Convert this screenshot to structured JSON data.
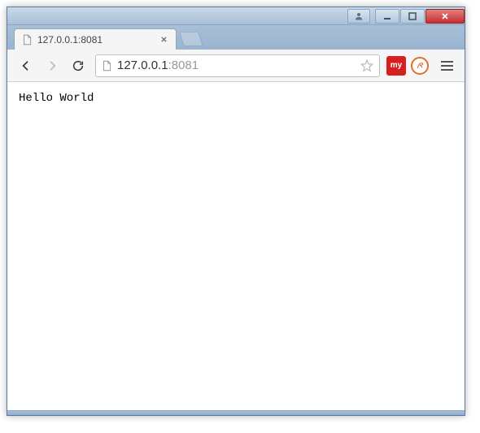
{
  "window": {
    "controls": {
      "user": "user",
      "minimize": "minimize",
      "maximize": "maximize",
      "close": "close"
    }
  },
  "tabs": [
    {
      "title": "127.0.0.1:8081",
      "favicon": "file-icon"
    }
  ],
  "toolbar": {
    "back": "back",
    "forward": "forward",
    "reload": "reload",
    "menu": "menu"
  },
  "omnibox": {
    "favicon": "file-icon",
    "host": "127.0.0.1",
    "port": ":8081",
    "bookmark": "star"
  },
  "extensions": [
    {
      "name": "my-extension",
      "label": "my",
      "style": "red-box"
    },
    {
      "name": "scribe-extension",
      "label": "",
      "style": "circle"
    }
  ],
  "page": {
    "body_text": "Hello World"
  }
}
